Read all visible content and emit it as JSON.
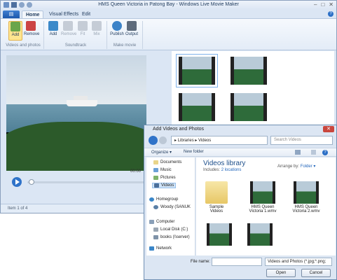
{
  "main_window": {
    "title": "HMS Queen Victoria in Patong Bay - Windows Live Movie Maker",
    "file_tab": "▤",
    "tabs": [
      "Home",
      "Visual Effects",
      "Edit"
    ],
    "ribbon": {
      "groups": [
        "Videos and photos",
        "Soundtrack",
        "Make movie"
      ],
      "buttons": [
        {
          "label": "Add",
          "enabled": true
        },
        {
          "label": "Remove",
          "enabled": true
        },
        {
          "label": "Add",
          "enabled": true
        },
        {
          "label": "Remove",
          "enabled": false
        },
        {
          "label": "Fit",
          "enabled": false
        },
        {
          "label": "Mix",
          "enabled": false
        },
        {
          "label": "Publish",
          "enabled": true
        },
        {
          "label": "Output",
          "enabled": true
        }
      ]
    },
    "time": "00:00",
    "status": "Item 1 of 4"
  },
  "dialog": {
    "title": "Add Videos and Photos",
    "address": "▸ Libraries ▸ Videos",
    "search_placeholder": "Search Videos",
    "toolbar": {
      "organize": "Organize ▾",
      "new_folder": "New folder"
    },
    "nav": [
      "Documents",
      "Music",
      "Pictures",
      "Videos",
      "Homegroup",
      "Woody (SANUK",
      "Computer",
      "Local Disk (C:)",
      "books (\\\\server)",
      "Network"
    ],
    "library_title": "Videos library",
    "includes_label": "Includes:",
    "includes_link": "2 locations",
    "arrange_label": "Arrange by:",
    "arrange_value": "Folder ▾",
    "files": [
      {
        "name": "Sample Videos"
      },
      {
        "name": "HMS Queen Victoria 1.wmv"
      },
      {
        "name": "HMS Queen Victoria 2.wmv"
      }
    ],
    "file_name_label": "File name:",
    "file_type": "Videos and Photos (*.jpg;*.png;",
    "open": "Open",
    "cancel": "Cancel"
  },
  "colors": {
    "accent": "#2f73c9",
    "link": "#2266bb"
  }
}
